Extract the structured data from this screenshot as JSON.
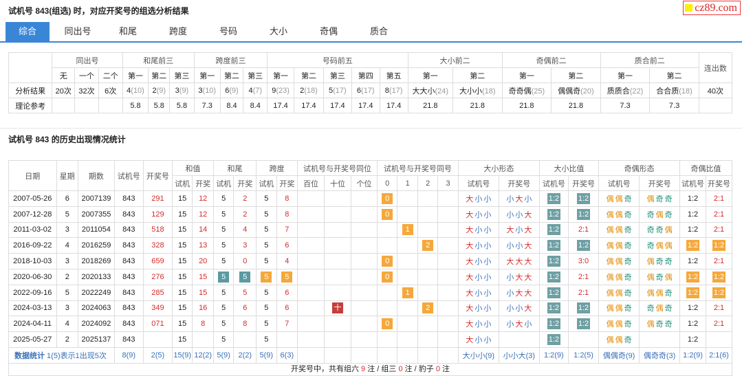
{
  "title": "试机号 843(组选) 时，对应开奖号的组选分析结果",
  "logo": "cz89.com",
  "tabs": [
    "综合",
    "同出号",
    "和尾",
    "跨度",
    "号码",
    "大小",
    "奇偶",
    "质合"
  ],
  "analysis": {
    "groups": [
      "同出号",
      "和尾前三",
      "跨度前三",
      "号码前五",
      "大小前二",
      "奇偶前二",
      "质合前二",
      "连出数"
    ],
    "subheaders": [
      "无",
      "一个",
      "二个",
      "第一",
      "第二",
      "第三",
      "第一",
      "第二",
      "第三",
      "第一",
      "第二",
      "第三",
      "第四",
      "第五",
      "第一",
      "第二",
      "第一",
      "第二",
      "第一",
      "第二"
    ],
    "row_result_label": "分析结果",
    "row_theory_label": "理论参考",
    "result": [
      [
        "20次"
      ],
      [
        "32次"
      ],
      [
        "6次"
      ],
      [
        "4",
        "(10)"
      ],
      [
        "2",
        "(9)"
      ],
      [
        "3",
        "(9)"
      ],
      [
        "3",
        "(10)"
      ],
      [
        "6",
        "(9)"
      ],
      [
        "4",
        "(7)"
      ],
      [
        "9",
        "(23)"
      ],
      [
        "2",
        "(18)"
      ],
      [
        "5",
        "(17)"
      ],
      [
        "6",
        "(17)"
      ],
      [
        "8",
        "(17)"
      ],
      [
        "大大小",
        "(24)"
      ],
      [
        "大小小",
        "(18)"
      ],
      [
        "奇奇偶",
        "(25)"
      ],
      [
        "偶偶奇",
        "(20)"
      ],
      [
        "质质合",
        "(22)"
      ],
      [
        "合合质",
        "(18)"
      ],
      [
        "40次"
      ]
    ],
    "theory": [
      "",
      "",
      "",
      "5.8",
      "5.8",
      "5.8",
      "7.3",
      "8.4",
      "8.4",
      "17.4",
      "17.4",
      "17.4",
      "17.4",
      "17.4",
      "21.8",
      "21.8",
      "21.8",
      "21.8",
      "7.3",
      "7.3",
      ""
    ]
  },
  "history_title": "试机号 843 的历史出现情况统计",
  "history": {
    "groups": [
      "日期",
      "星期",
      "期数",
      "试机号",
      "开奖号",
      "和值",
      "和尾",
      "跨度",
      "试机号与开奖号同位",
      "试机号与开奖号同号",
      "大小形态",
      "大小比值",
      "奇偶形态",
      "奇偶比值"
    ],
    "subheaders": [
      "试机",
      "开奖",
      "试机",
      "开奖",
      "试机",
      "开奖",
      "百位",
      "十位",
      "个位",
      "0",
      "1",
      "2",
      "3",
      "试机号",
      "开奖号",
      "试机号",
      "开奖号",
      "试机号",
      "开奖号",
      "试机号",
      "开奖号"
    ],
    "rows": [
      {
        "date": "2007-05-26",
        "wk": "6",
        "issue": "2007139",
        "test": "843",
        "draw": "291",
        "sum_t": "15",
        "sum_d": "12",
        "tail_t": "5",
        "tail_d": "2",
        "span_t": "5",
        "span_d": "8",
        "pos": [
          "",
          "",
          ""
        ],
        "same": [
          "0",
          "",
          "",
          ""
        ],
        "bs_t": [
          "大",
          "小",
          "小"
        ],
        "bs_d": [
          "小",
          "大",
          "小"
        ],
        "bsr_t": "1:2",
        "bsr_d": "1:2",
        "oe_t": [
          "偶",
          "偶",
          "奇"
        ],
        "oe_d": [
          "偶",
          "奇",
          "奇"
        ],
        "oer_t": "1:2",
        "oer_d": "2:1",
        "hl": {}
      },
      {
        "date": "2007-12-28",
        "wk": "5",
        "issue": "2007355",
        "test": "843",
        "draw": "129",
        "sum_t": "15",
        "sum_d": "12",
        "tail_t": "5",
        "tail_d": "2",
        "span_t": "5",
        "span_d": "8",
        "pos": [
          "",
          "",
          ""
        ],
        "same": [
          "0",
          "",
          "",
          ""
        ],
        "bs_t": [
          "大",
          "小",
          "小"
        ],
        "bs_d": [
          "小",
          "小",
          "大"
        ],
        "bsr_t": "1:2",
        "bsr_d": "1:2",
        "oe_t": [
          "偶",
          "偶",
          "奇"
        ],
        "oe_d": [
          "奇",
          "偶",
          "奇"
        ],
        "oer_t": "1:2",
        "oer_d": "2:1",
        "hl": {}
      },
      {
        "date": "2011-03-02",
        "wk": "3",
        "issue": "2011054",
        "test": "843",
        "draw": "518",
        "sum_t": "15",
        "sum_d": "14",
        "tail_t": "5",
        "tail_d": "4",
        "span_t": "5",
        "span_d": "7",
        "pos": [
          "",
          "",
          ""
        ],
        "same": [
          "",
          "1",
          "",
          ""
        ],
        "bs_t": [
          "大",
          "小",
          "小"
        ],
        "bs_d": [
          "大",
          "小",
          "大"
        ],
        "bsr_t": "1:2",
        "bsr_d": "2:1",
        "oe_t": [
          "偶",
          "偶",
          "奇"
        ],
        "oe_d": [
          "奇",
          "奇",
          "偶"
        ],
        "oer_t": "1:2",
        "oer_d": "2:1",
        "hl": {}
      },
      {
        "date": "2016-09-22",
        "wk": "4",
        "issue": "2016259",
        "test": "843",
        "draw": "328",
        "sum_t": "15",
        "sum_d": "13",
        "tail_t": "5",
        "tail_d": "3",
        "span_t": "5",
        "span_d": "6",
        "pos": [
          "",
          "",
          ""
        ],
        "same": [
          "",
          "",
          "2",
          ""
        ],
        "bs_t": [
          "大",
          "小",
          "小"
        ],
        "bs_d": [
          "小",
          "小",
          "大"
        ],
        "bsr_t": "1:2",
        "bsr_d": "1:2",
        "oe_t": [
          "偶",
          "偶",
          "奇"
        ],
        "oe_d": [
          "奇",
          "偶",
          "偶"
        ],
        "oer_t": "1:2",
        "oer_d": "1:2",
        "hl": {
          "oer": true
        }
      },
      {
        "date": "2018-10-03",
        "wk": "3",
        "issue": "2018269",
        "test": "843",
        "draw": "659",
        "sum_t": "15",
        "sum_d": "20",
        "tail_t": "5",
        "tail_d": "0",
        "span_t": "5",
        "span_d": "4",
        "pos": [
          "",
          "",
          ""
        ],
        "same": [
          "0",
          "",
          "",
          ""
        ],
        "bs_t": [
          "大",
          "小",
          "小"
        ],
        "bs_d": [
          "大",
          "大",
          "大"
        ],
        "bsr_t": "1:2",
        "bsr_d": "3:0",
        "oe_t": [
          "偶",
          "偶",
          "奇"
        ],
        "oe_d": [
          "偶",
          "奇",
          "奇"
        ],
        "oer_t": "1:2",
        "oer_d": "2:1",
        "hl": {}
      },
      {
        "date": "2020-06-30",
        "wk": "2",
        "issue": "2020133",
        "test": "843",
        "draw": "276",
        "sum_t": "15",
        "sum_d": "15",
        "tail_t": "5",
        "tail_d": "5",
        "span_t": "5",
        "span_d": "5",
        "pos": [
          "",
          "",
          ""
        ],
        "same": [
          "0",
          "",
          "",
          ""
        ],
        "bs_t": [
          "大",
          "小",
          "小"
        ],
        "bs_d": [
          "小",
          "大",
          "大"
        ],
        "bsr_t": "1:2",
        "bsr_d": "2:1",
        "oe_t": [
          "偶",
          "偶",
          "奇"
        ],
        "oe_d": [
          "偶",
          "奇",
          "偶"
        ],
        "oer_t": "1:2",
        "oer_d": "1:2",
        "hl": {
          "tail": true,
          "span": true,
          "oer": true
        }
      },
      {
        "date": "2022-09-16",
        "wk": "5",
        "issue": "2022249",
        "test": "843",
        "draw": "285",
        "sum_t": "15",
        "sum_d": "15",
        "tail_t": "5",
        "tail_d": "5",
        "span_t": "5",
        "span_d": "6",
        "pos": [
          "",
          "",
          ""
        ],
        "same": [
          "",
          "1",
          "",
          ""
        ],
        "bs_t": [
          "大",
          "小",
          "小"
        ],
        "bs_d": [
          "小",
          "大",
          "大"
        ],
        "bsr_t": "1:2",
        "bsr_d": "2:1",
        "oe_t": [
          "偶",
          "偶",
          "奇"
        ],
        "oe_d": [
          "偶",
          "偶",
          "奇"
        ],
        "oer_t": "1:2",
        "oer_d": "1:2",
        "hl": {
          "oer": true
        }
      },
      {
        "date": "2024-03-13",
        "wk": "3",
        "issue": "2024063",
        "test": "843",
        "draw": "349",
        "sum_t": "15",
        "sum_d": "16",
        "tail_t": "5",
        "tail_d": "6",
        "span_t": "5",
        "span_d": "6",
        "pos": [
          "",
          "十",
          ""
        ],
        "same": [
          "",
          "",
          "2",
          ""
        ],
        "bs_t": [
          "大",
          "小",
          "小"
        ],
        "bs_d": [
          "小",
          "小",
          "大"
        ],
        "bsr_t": "1:2",
        "bsr_d": "1:2",
        "oe_t": [
          "偶",
          "偶",
          "奇"
        ],
        "oe_d": [
          "奇",
          "偶",
          "奇"
        ],
        "oer_t": "1:2",
        "oer_d": "2:1",
        "hl": {}
      },
      {
        "date": "2024-04-11",
        "wk": "4",
        "issue": "2024092",
        "test": "843",
        "draw": "071",
        "sum_t": "15",
        "sum_d": "8",
        "tail_t": "5",
        "tail_d": "8",
        "span_t": "5",
        "span_d": "7",
        "pos": [
          "",
          "",
          ""
        ],
        "same": [
          "0",
          "",
          "",
          ""
        ],
        "bs_t": [
          "大",
          "小",
          "小"
        ],
        "bs_d": [
          "小",
          "大",
          "小"
        ],
        "bsr_t": "1:2",
        "bsr_d": "1:2",
        "oe_t": [
          "偶",
          "偶",
          "奇"
        ],
        "oe_d": [
          "偶",
          "奇",
          "奇"
        ],
        "oer_t": "1:2",
        "oer_d": "2:1",
        "hl": {}
      },
      {
        "date": "2025-05-27",
        "wk": "2",
        "issue": "2025137",
        "test": "843",
        "draw": "",
        "sum_t": "15",
        "sum_d": "",
        "tail_t": "5",
        "tail_d": "",
        "span_t": "5",
        "span_d": "",
        "pos": [
          "",
          "",
          ""
        ],
        "same": [
          "",
          "",
          "",
          ""
        ],
        "bs_t": [
          "大",
          "小",
          "小"
        ],
        "bs_d": [
          "",
          "",
          ""
        ],
        "bsr_t": "1:2",
        "bsr_d": "",
        "oe_t": [
          "偶",
          "偶",
          "奇"
        ],
        "oe_d": [
          "",
          "",
          ""
        ],
        "oer_t": "1:2",
        "oer_d": "",
        "hl": {}
      }
    ],
    "stats": {
      "label": "数据统计",
      "appear": "1(5)表示1出现5次",
      "cells": [
        "8(9)",
        "2(5)",
        "15(9)",
        "12(2)",
        "5(9)",
        "2(2)",
        "5(9)",
        "6(3)",
        "",
        "",
        "",
        "",
        "",
        "",
        "",
        "大小小(9)",
        "小小大(3)",
        "1:2(9)",
        "1:2(5)",
        "偶偶奇(9)",
        "偶奇奇(3)",
        "1:2(9)",
        "2:1(6)"
      ]
    },
    "footer": {
      "prefix": "开奖号中，共有组六 ",
      "g6": "9",
      "mid1": " 注 / 组三 ",
      "g3": "0",
      "mid2": " 注 / 豹子 ",
      "bz": "0",
      "suffix": " 注"
    }
  }
}
